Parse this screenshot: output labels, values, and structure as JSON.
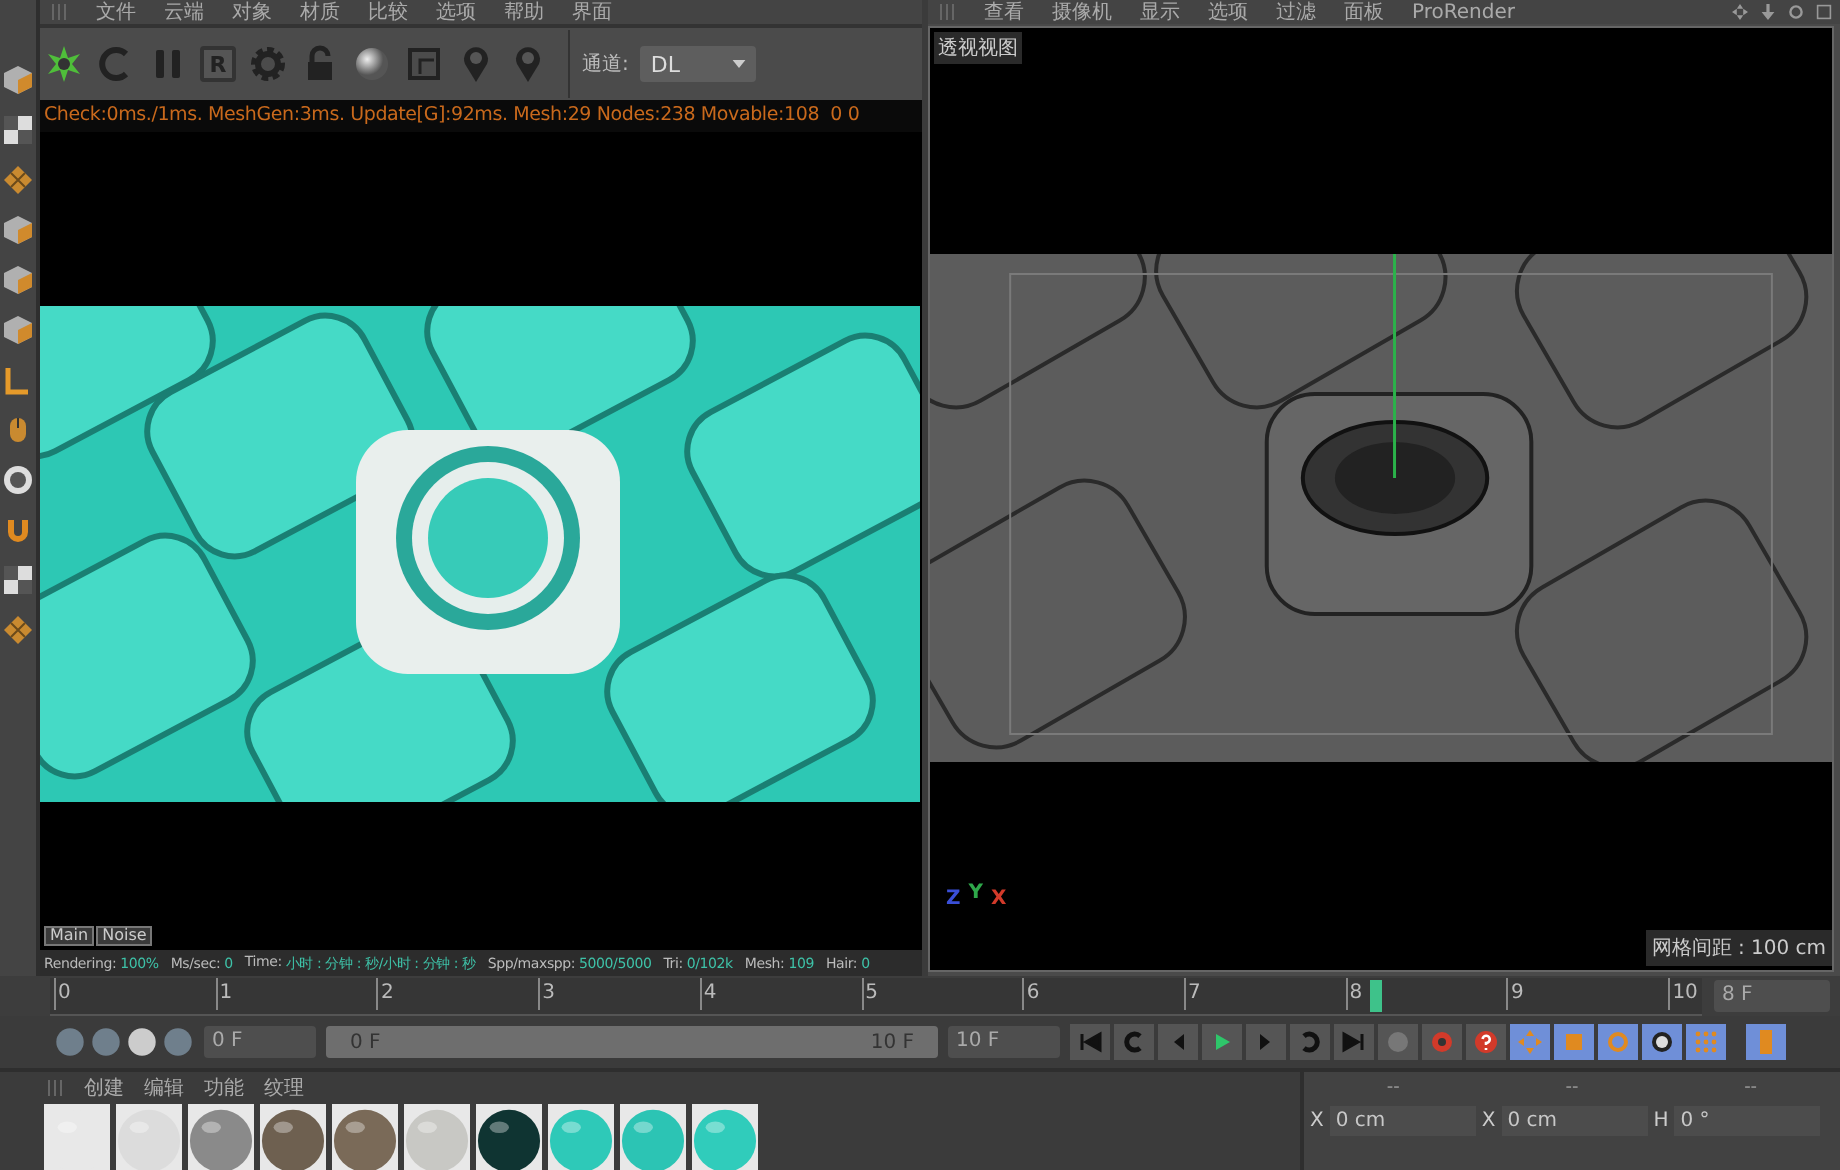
{
  "render_view": {
    "menu": [
      "文件",
      "云端",
      "对象",
      "材质",
      "比较",
      "选项",
      "帮助",
      "界面"
    ],
    "toolbar": {
      "glyph": "R",
      "channel_label": "通道:",
      "channel_value": "DL"
    },
    "log": "Check:0ms./1ms. MeshGen:3ms. Update[G]:92ms. Mesh:29 Nodes:238 Movable:108  0 0",
    "tabs": [
      {
        "label": "Main",
        "selected": false
      },
      {
        "label": "Noise",
        "selected": false
      }
    ],
    "stats": [
      {
        "label": "Rendering:",
        "value": "100%"
      },
      {
        "label": "Ms/sec:",
        "value": "0"
      },
      {
        "label": "Time:",
        "value": "小时 : 分钟 : 秒/小时 : 分钟 : 秒"
      },
      {
        "label": "Spp/maxspp:",
        "value": "5000/5000"
      },
      {
        "label": "Tri:",
        "value": "0/102k"
      },
      {
        "label": "Mesh:",
        "value": "109"
      },
      {
        "label": "Hair:",
        "value": "0"
      }
    ]
  },
  "viewport": {
    "menu": [
      "查看",
      "摄像机",
      "显示",
      "选项",
      "过滤",
      "面板",
      "ProRender"
    ],
    "title": "透视视图",
    "axes": [
      "Z",
      "Y",
      "X"
    ],
    "grid_spacing": "网格间距 : 100 cm"
  },
  "timeline": {
    "ticks": [
      "0",
      "1",
      "2",
      "3",
      "4",
      "5",
      "6",
      "7",
      "8",
      "9",
      "10"
    ],
    "level": 0.8,
    "frame_field": "8 F"
  },
  "transport": {
    "start_field": "0 F",
    "level": 1,
    "range_start": "0 F",
    "range_end": "10 F",
    "end_field": "10 F"
  },
  "materials": {
    "menu": [
      "创建",
      "编辑",
      "功能",
      "纹理"
    ],
    "balls": [
      {
        "color": "#e8e8e8"
      },
      {
        "color": "#dcdcdc"
      },
      {
        "color": "#8a8a8a"
      },
      {
        "color": "#6e6050"
      },
      {
        "color": "#7a6a58"
      },
      {
        "color": "#c8c8c4"
      },
      {
        "color": "#0f3432"
      },
      {
        "color": "#2ec9b8"
      },
      {
        "color": "#2cc4b4"
      },
      {
        "color": "#30ccbb"
      }
    ]
  },
  "coordinates": {
    "headers": [
      "--",
      "--",
      "--"
    ],
    "fields": [
      {
        "axis": "X",
        "value": "0 cm"
      },
      {
        "axis": "X",
        "value": "0 cm"
      },
      {
        "axis": "H",
        "value": "0 °"
      }
    ]
  }
}
